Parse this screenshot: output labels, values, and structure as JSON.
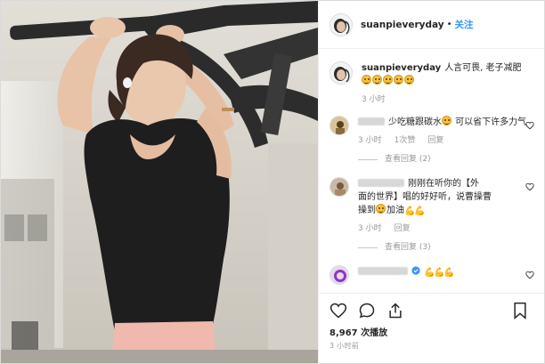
{
  "post": {
    "username": "suanpieveryday",
    "separator": "•",
    "follow_label": "关注"
  },
  "caption": {
    "username": "suanpieveryday",
    "text": "人言可畏, 老子减肥",
    "emoji_count": 5,
    "time": "3 小时"
  },
  "comments": [
    {
      "text_before": "少吃糖跟碳水",
      "text_after": " 可以省下许多力气",
      "time": "3 小时",
      "likes": "1次赞",
      "reply": "回复",
      "view_replies": "查看回复 (2)"
    },
    {
      "text_line1": "刚刚在听你的【外",
      "text_line2": "面的世界】唱的好好听，说曹操曹",
      "text_line3": "操到",
      "text_after": "加油",
      "time": "3 小时",
      "reply": "回复",
      "view_replies": "查看回复 (3)"
    },
    {
      "verified": true
    }
  ],
  "stats": {
    "views": "8,967 次播放",
    "posted": "3 小时前"
  },
  "icons": {
    "like": "heart-icon",
    "comment": "comment-icon",
    "share": "share-icon",
    "save": "bookmark-icon",
    "comment_like": "heart-small-icon",
    "verified": "verified-badge-icon",
    "flex": "flexed-biceps-emoji"
  },
  "colors": {
    "link_blue": "#3897f0",
    "muted_gray": "#999999",
    "text": "#262626",
    "border": "#efefef"
  }
}
